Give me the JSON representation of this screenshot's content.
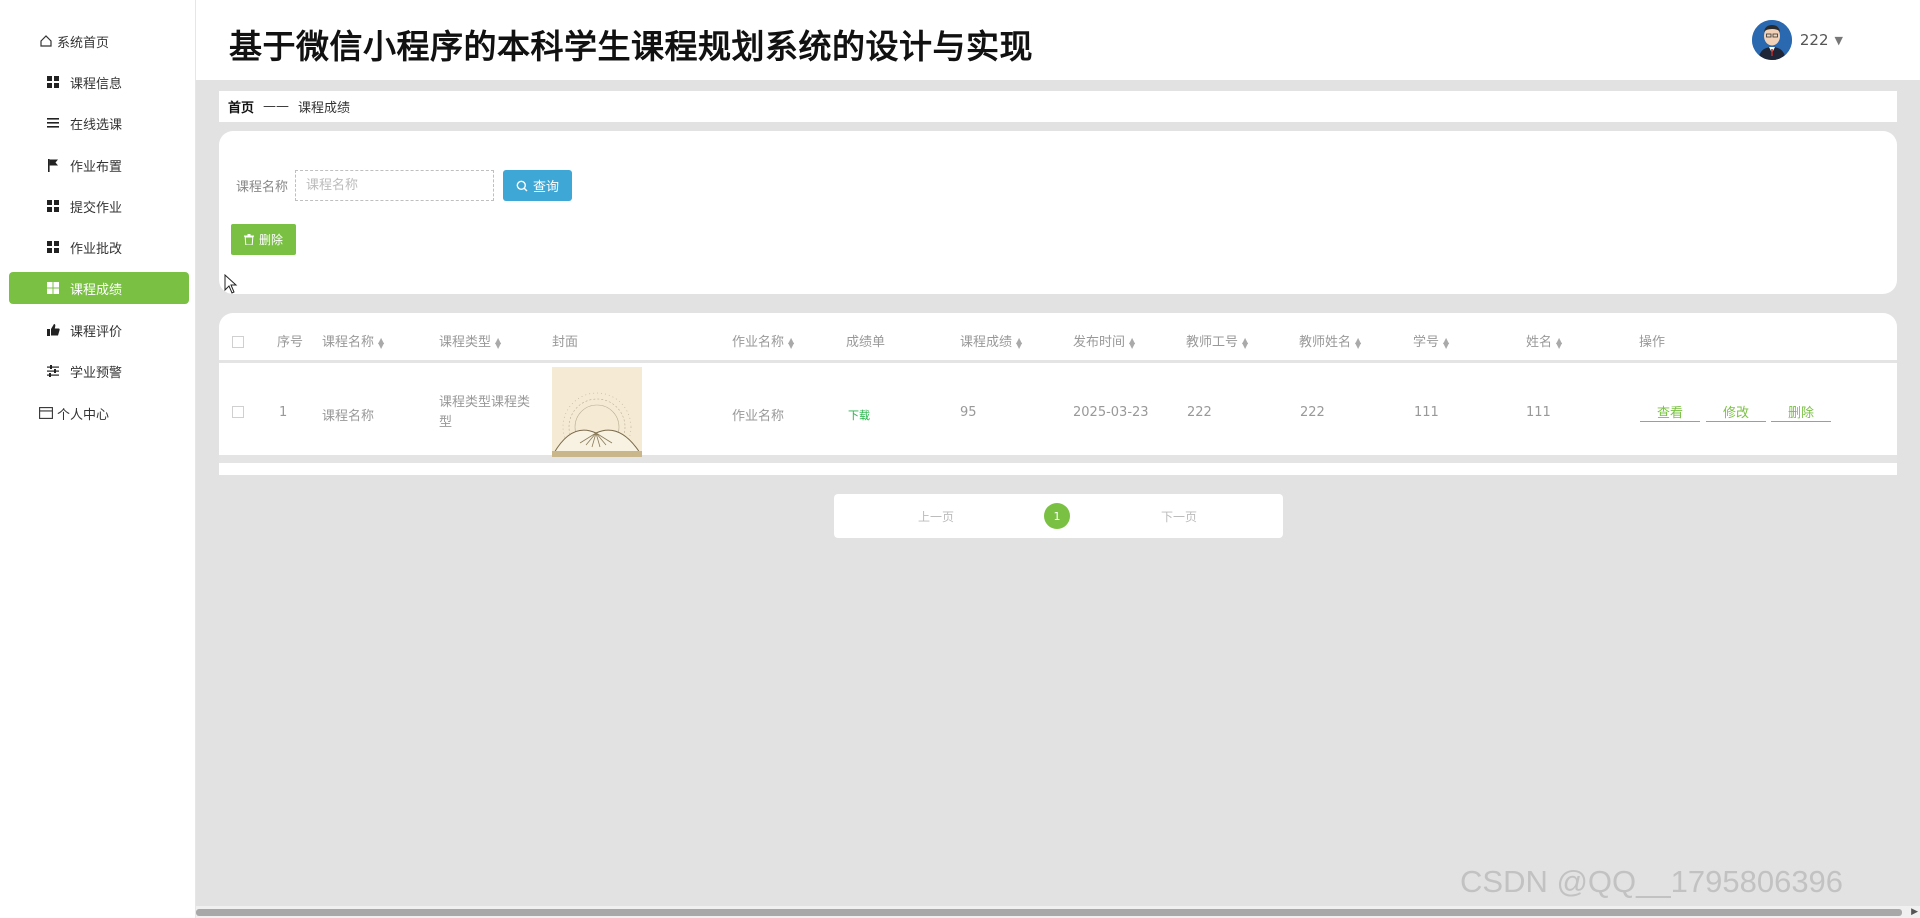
{
  "app": {
    "title": "基于微信小程序的本科学生课程规划系统的设计与实现"
  },
  "user": {
    "name": "222",
    "caret": "▼"
  },
  "sidebar": {
    "items": [
      {
        "label": "系统首页",
        "icon": "home-icon"
      },
      {
        "label": "课程信息",
        "icon": "grid-icon"
      },
      {
        "label": "在线选课",
        "icon": "list-icon"
      },
      {
        "label": "作业布置",
        "icon": "flag-icon"
      },
      {
        "label": "提交作业",
        "icon": "grid-icon"
      },
      {
        "label": "作业批改",
        "icon": "grid-icon"
      },
      {
        "label": "课程成绩",
        "icon": "grid-icon",
        "active": true
      },
      {
        "label": "课程评价",
        "icon": "thumb-icon"
      },
      {
        "label": "学业预警",
        "icon": "sliders-icon"
      },
      {
        "label": "个人中心",
        "icon": "card-icon"
      }
    ]
  },
  "breadcrumb": {
    "home": "首页",
    "separator": "——",
    "current": "课程成绩"
  },
  "search": {
    "label": "课程名称",
    "placeholder": "课程名称",
    "value": "",
    "query_label": "查询",
    "delete_label": "删除"
  },
  "table": {
    "columns": [
      "序号",
      "课程名称",
      "课程类型",
      "封面",
      "作业名称",
      "成绩单",
      "课程成绩",
      "发布时间",
      "教师工号",
      "教师姓名",
      "学号",
      "姓名",
      "操作"
    ],
    "rows": [
      {
        "index": "1",
        "course_name": "课程名称",
        "course_type": "课程类型课程类型",
        "homework_name": "作业名称",
        "report": "下载",
        "score": "95",
        "publish_time": "2025-03-23",
        "teacher_id": "222",
        "teacher_name": "222",
        "student_id": "111",
        "student_name": "111",
        "actions": [
          "查看",
          "修改",
          "删除"
        ]
      }
    ]
  },
  "pagination": {
    "prev": "上一页",
    "current": "1",
    "next": "下一页"
  },
  "watermark": "CSDN @QQ__1795806396",
  "colors": {
    "accent": "#7ac143",
    "query": "#3fa7d6",
    "download": "#2ab24b"
  }
}
